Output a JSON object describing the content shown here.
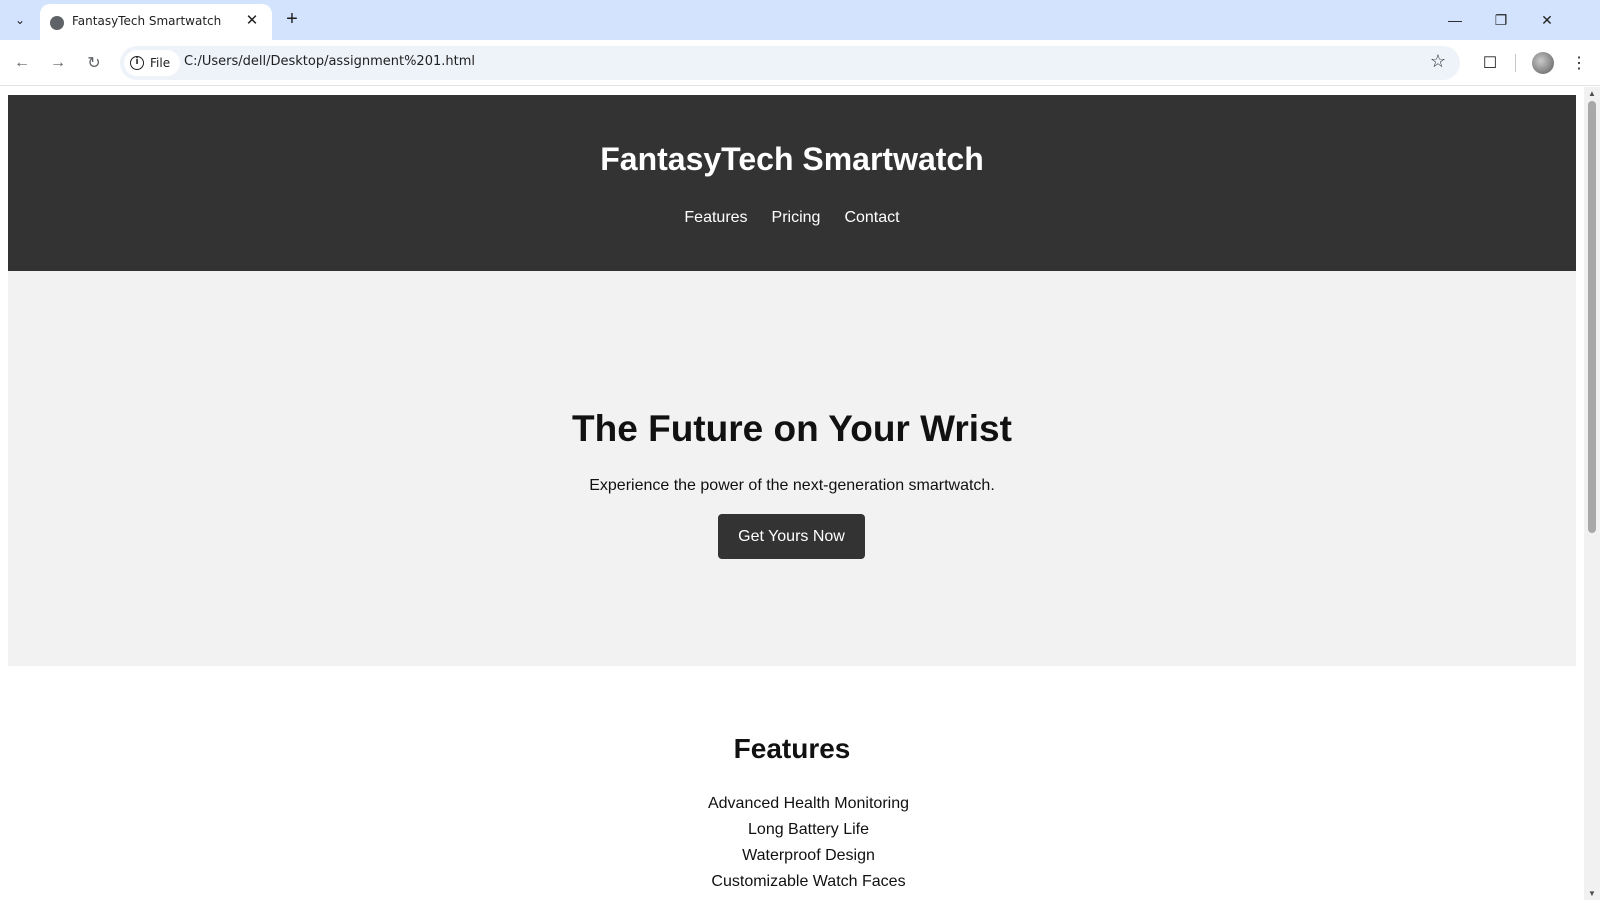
{
  "browser": {
    "tab_title": "FantasyTech Smartwatch",
    "omnibox_chip": "File",
    "url": "C:/Users/dell/Desktop/assignment%201.html"
  },
  "site": {
    "title": "FantasyTech Smartwatch",
    "nav": [
      "Features",
      "Pricing",
      "Contact"
    ]
  },
  "hero": {
    "heading": "The Future on Your Wrist",
    "subheading": "Experience the power of the next-generation smartwatch.",
    "cta_label": "Get Yours Now"
  },
  "features": {
    "heading": "Features",
    "items": [
      "Advanced Health Monitoring",
      "Long Battery Life",
      "Waterproof Design",
      "Customizable Watch Faces"
    ]
  },
  "colors": {
    "header_bg": "#333333",
    "hero_bg": "#f2f2f2",
    "tabstrip_bg": "#d3e3fd"
  }
}
